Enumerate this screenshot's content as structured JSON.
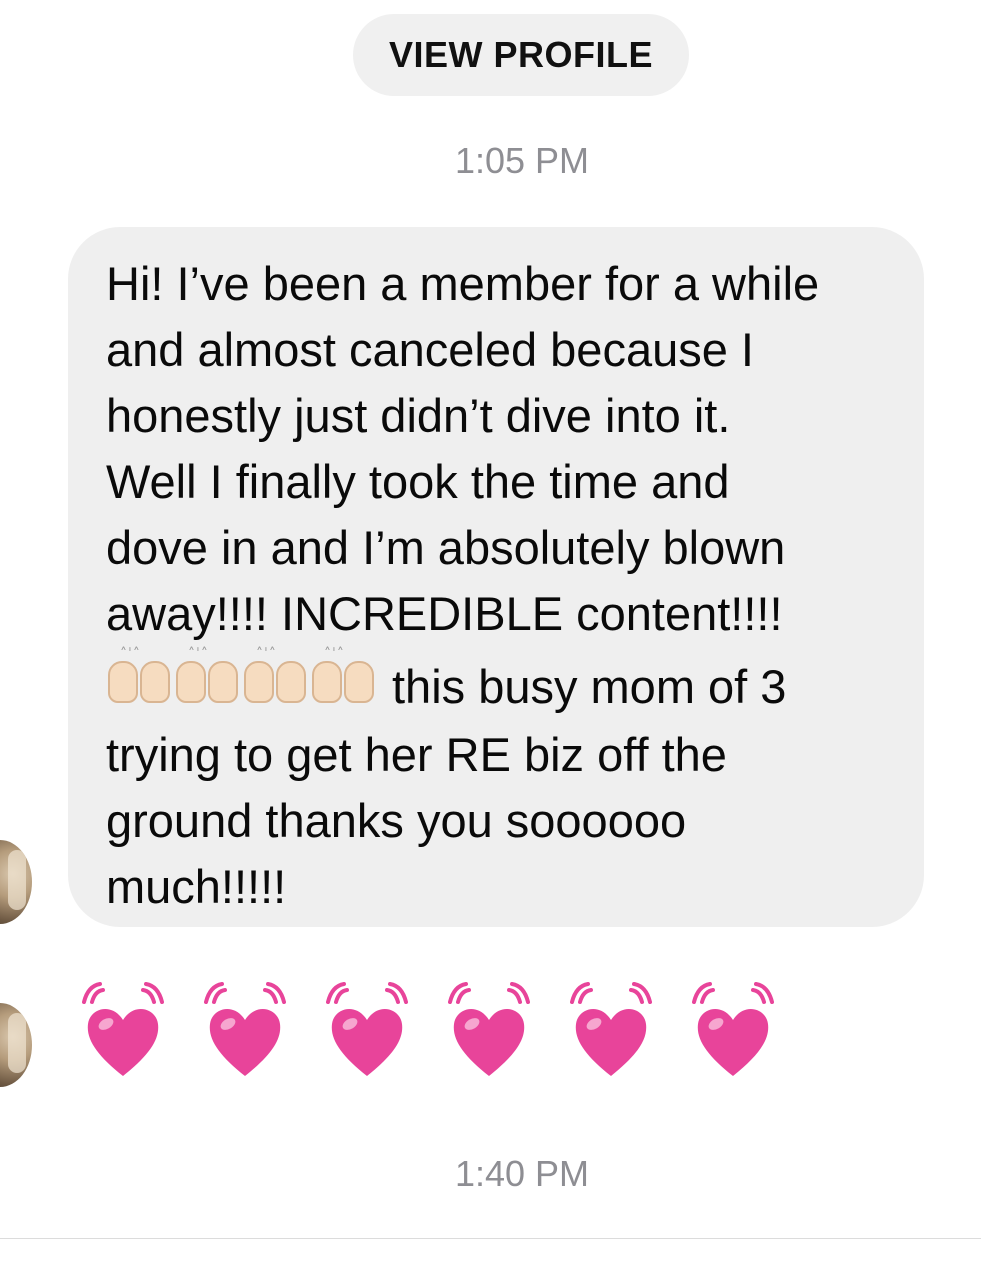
{
  "header": {
    "view_profile_label": "VIEW PROFILE"
  },
  "thread": {
    "timestamp_1": "1:05 PM",
    "timestamp_2": "1:40 PM",
    "message": {
      "lines": [
        "Hi! I’ve been a member for a while",
        "and almost canceled because I",
        "honestly just didn’t dive into it.",
        "Well I finally took the time and",
        "dove in and I’m absolutely blown",
        "away!!!! INCREDIBLE content!!!!",
        "this busy mom of 3",
        "trying to get her RE biz off the",
        "ground thanks you soooooo",
        "much!!!!!"
      ],
      "emoji_count": 4,
      "emoji_icon": "raising-hands-icon"
    },
    "reaction": {
      "heart_count": 6,
      "heart_icon": "beating-heart-icon",
      "heart_color": "#e8449a"
    }
  },
  "colors": {
    "bubble": "#efefef",
    "pill": "#f0f0f0",
    "timestamp": "#8e8e93"
  }
}
